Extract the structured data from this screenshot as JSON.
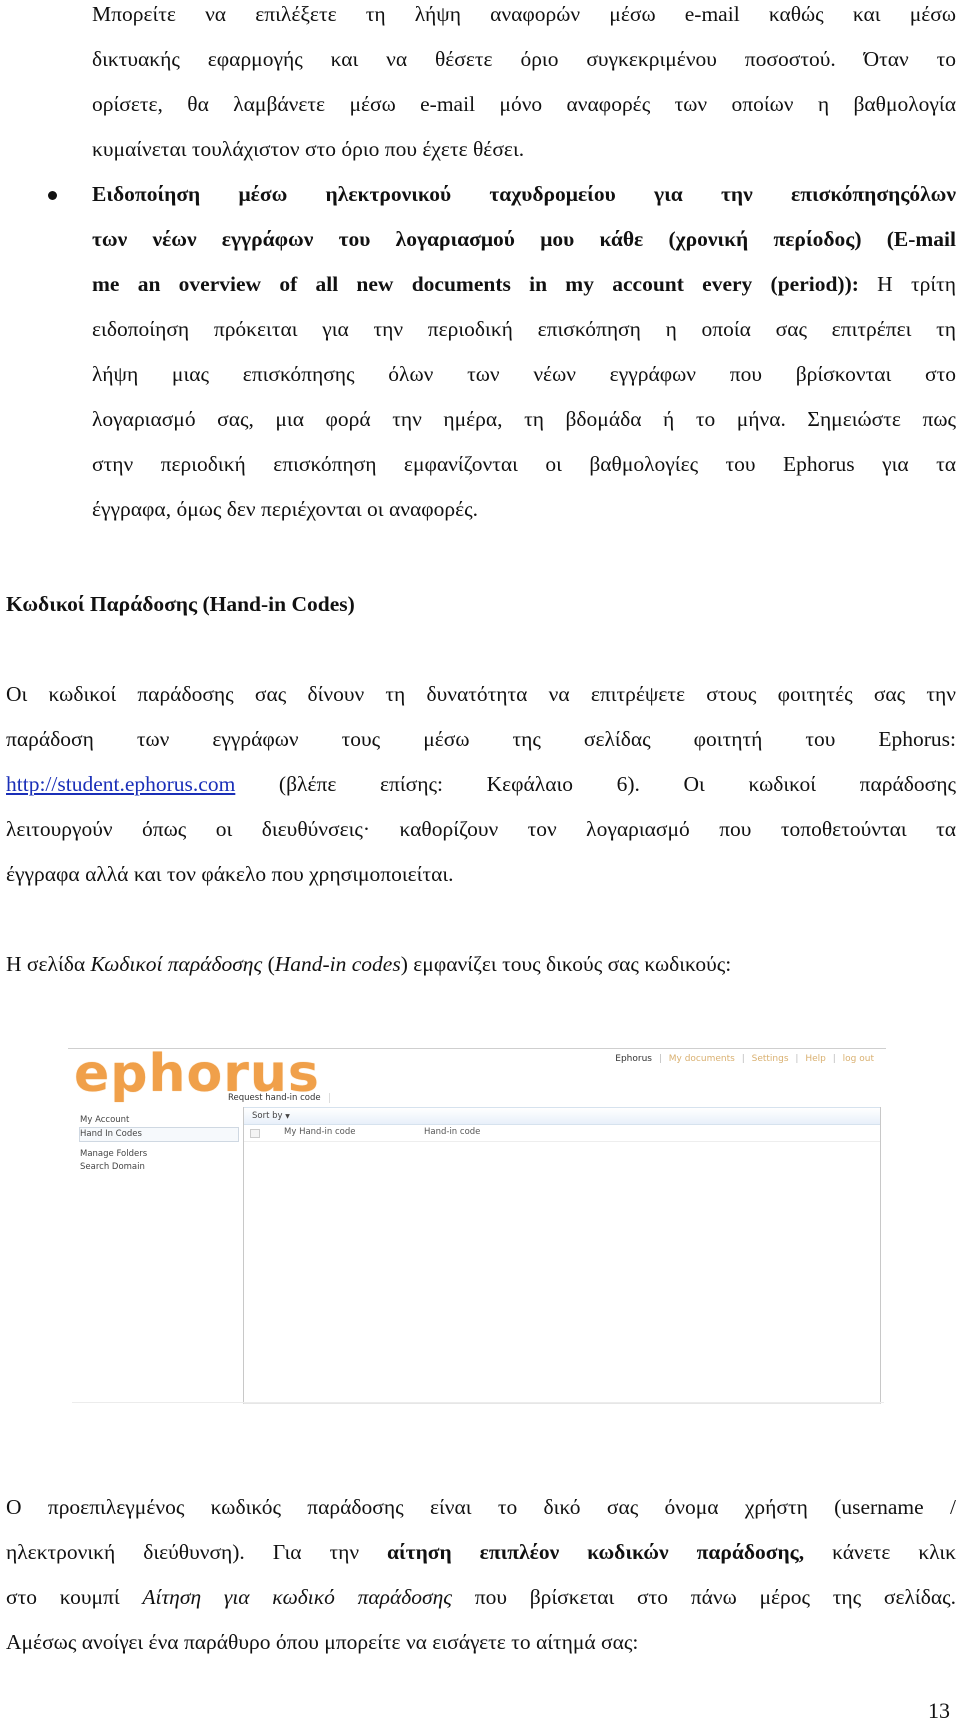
{
  "paragraph1": {
    "lines": [
      "Μπορείτε να επιλέξετε τη λήψη αναφορών μέσω e-mail καθώς και μέσω",
      "δικτυακής εφαρμογής και να θέσετε όριο συγκεκριμένου ποσοστού. Όταν το",
      "ορίσετε, θα λαμβάνετε μέσω e-mail μόνο αναφορές των οποίων η βαθμολογία",
      "κυμαίνεται τουλάχιστον στο όριο που έχετε θέσει."
    ]
  },
  "bullet": {
    "bold_lines": [
      "Ειδοποίηση μέσω ηλεκτρονικού ταχυδρομείου για την επισκόπησηςόλων",
      "των νέων εγγράφων του λογαριασμού μου κάθε (χρονική περίοδος) (E-mail"
    ],
    "line3_bold": "me an overview of all new documents in my account every (period)):",
    "line3_rest": " Η τρίτη",
    "lines": [
      "ειδοποίηση πρόκειται για την περιοδική επισκόπηση η οποία σας επιτρέπει τη",
      "λήψη μιας επισκόπησης όλων των νέων εγγράφων που βρίσκονται στο",
      "λογαριασμό σας, μια φορά την ημέρα, τη βδομάδα ή το μήνα. Σημειώστε πως",
      "στην περιοδική επισκόπηση εμφανίζονται οι βαθμολογίες του Ephorus για τα",
      "έγγραφα, όμως δεν περιέχονται οι αναφορές."
    ]
  },
  "section": {
    "heading": "Κωδικοί Παράδοσης (Hand-in Codes)",
    "p1_line1": "Οι κωδικοί παράδοσης σας δίνουν τη δυνατότητα να επιτρέψετε στους φοιτητές σας την",
    "p1_line2": "παράδοση των εγγράφων τους μέσω της σελίδας φοιτητή του Ephorus:",
    "p1_link": "http://student.ephorus.com",
    "p1_line3_rest": " (βλέπε επίσης: Κεφάλαιο 6). Οι κωδικοί παράδοσης",
    "p1_line4": "λειτουργούν όπως οι διευθύνσεις· καθορίζουν τον λογαριασμό που τοποθετούνται τα",
    "p1_line5": "έγγραφα αλλά και τον φάκελο που χρησιμοποιείται.",
    "p2_pre": "Η σελίδα ",
    "p2_italic1": "Κωδικοί παράδοσης",
    "p2_mid": " (",
    "p2_italic2": "Hand-in codes",
    "p2_post": ") εμφανίζει τους δικούς σας κωδικούς:"
  },
  "screenshot": {
    "logo": "ephorus",
    "top_nav": [
      "Ephorus",
      "My documents",
      "Settings",
      "Help",
      "log out"
    ],
    "left_nav": [
      "My Account",
      "Hand In Codes",
      "Manage Folders",
      "Search Domain"
    ],
    "active_nav": "Hand In Codes",
    "request_button": "Request hand-in code",
    "sort_by": "Sort by",
    "sort_arrow": "▼",
    "columns": [
      "My Hand-in code",
      "Hand-in code"
    ],
    "accent_color": "#f0a04a"
  },
  "paragraph3": {
    "line1": "Ο προεπιλεγμένος κωδικός παράδοσης είναι το δικό σας όνομα χρήστη (username /",
    "line2_pre": "ηλεκτρονική διεύθυνση). Για την ",
    "line2_bold": "αίτηση επιπλέον κωδικών παράδοσης,",
    "line2_post": " κάνετε κλικ",
    "line3_pre": "στο κουμπί ",
    "line3_italic": "Αίτηση για κωδικό παράδοσης",
    "line3_post": " που βρίσκεται στο πάνω μέρος της σελίδας.",
    "line4": "Αμέσως ανοίγει ένα παράθυρο όπου μπορείτε να εισάγετε το αίτημά σας:"
  },
  "page_number": "13"
}
